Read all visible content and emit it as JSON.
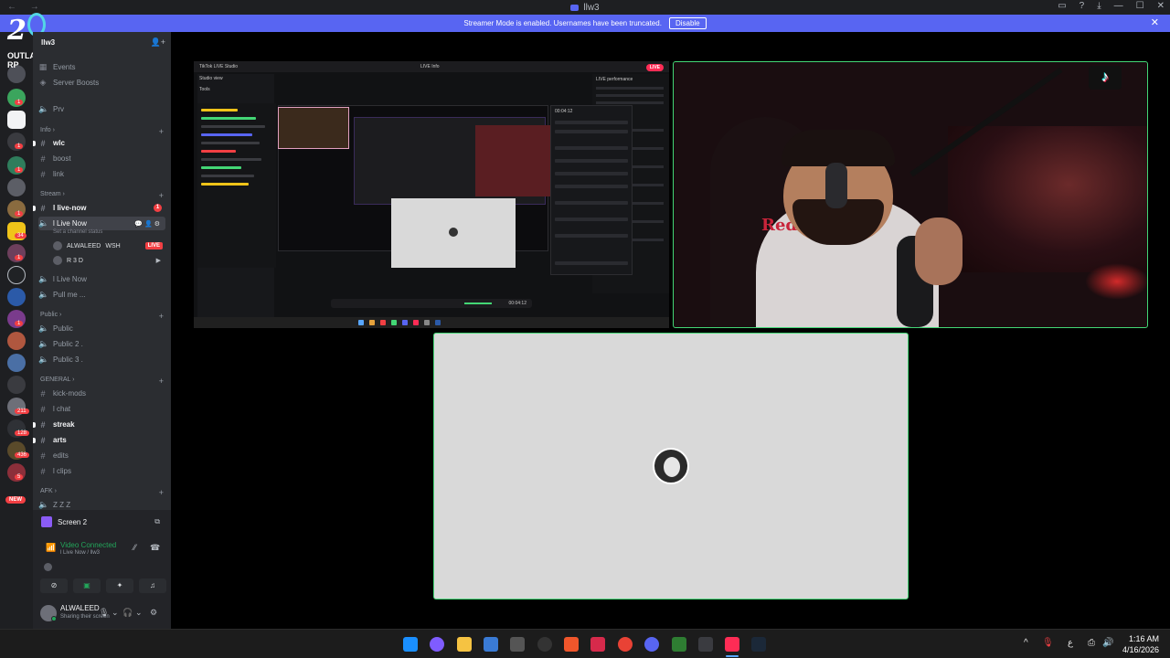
{
  "window": {
    "title": "llw3",
    "nav": "← →"
  },
  "banner": {
    "message": "Streamer Mode is enabled. Usernames have been truncated.",
    "disable_label": "Disable",
    "close": "✕",
    "color": "#5865f2"
  },
  "server_logo": {
    "number": "2",
    "brand": "OUTLAW RP"
  },
  "rail": {
    "badges": [
      "1",
      "1",
      "1",
      "1",
      "34",
      "1",
      "1",
      "211",
      "128",
      "436",
      "5"
    ],
    "new_label": "NEW"
  },
  "server": {
    "name": "llw3",
    "top_items": [
      "Events",
      "Server Boosts"
    ],
    "prv_channel": "Prv",
    "categories": {
      "info": "Info",
      "stream": "Stream",
      "public": "Public",
      "general": "GENERAL",
      "afk": "AFK"
    },
    "info_channels": [
      "wlc",
      "boost",
      "link"
    ],
    "stream_channels": {
      "live_now_text": "l live-now",
      "live_now_text_badge": "1",
      "live_now_voice": "l Live Now",
      "set_status": "Set a channel status",
      "users": [
        {
          "name": "ALWALEED",
          "tag": "WSH",
          "live": "LIVE"
        },
        {
          "name": "R 3 D"
        }
      ],
      "live_now_voice_2": "l Live Now",
      "pull_me": "Pull me ..."
    },
    "public_channels": [
      "Public",
      "Public 2 .",
      "Public 3 ."
    ],
    "general_channels": [
      "kick-mods",
      "l chat",
      "streak",
      "arts",
      "edits",
      "l clips"
    ],
    "afk_channel": "Z Z Z"
  },
  "screen_panel": {
    "label": "Screen 2"
  },
  "rtc": {
    "status": "Video Connected",
    "channel": "l Live Now / llw3"
  },
  "user_panel": {
    "name": "ALWALEED",
    "status": "Sharing their screen"
  },
  "studio": {
    "app_title": "TikTok LIVE Studio",
    "studio_view": "Studio view",
    "tools": "Tools",
    "live_info": "LIVE Info",
    "live_pill": "LIVE",
    "live_performance": "LIVE performance",
    "timer": "00:04:12",
    "controls_time": "00:04:12"
  },
  "cam": {
    "shirt_text": "RedBull",
    "logo_glyph": "♪"
  },
  "taskbar": {
    "time": "1:16 AM",
    "date": "4/16/2026",
    "tray": [
      "^",
      "🎙",
      "ع",
      "⎙",
      "🔊"
    ]
  },
  "colors": {
    "accent": "#5865f2",
    "online": "#23a55a",
    "danger": "#f23f43",
    "speaking": "#43d675"
  }
}
